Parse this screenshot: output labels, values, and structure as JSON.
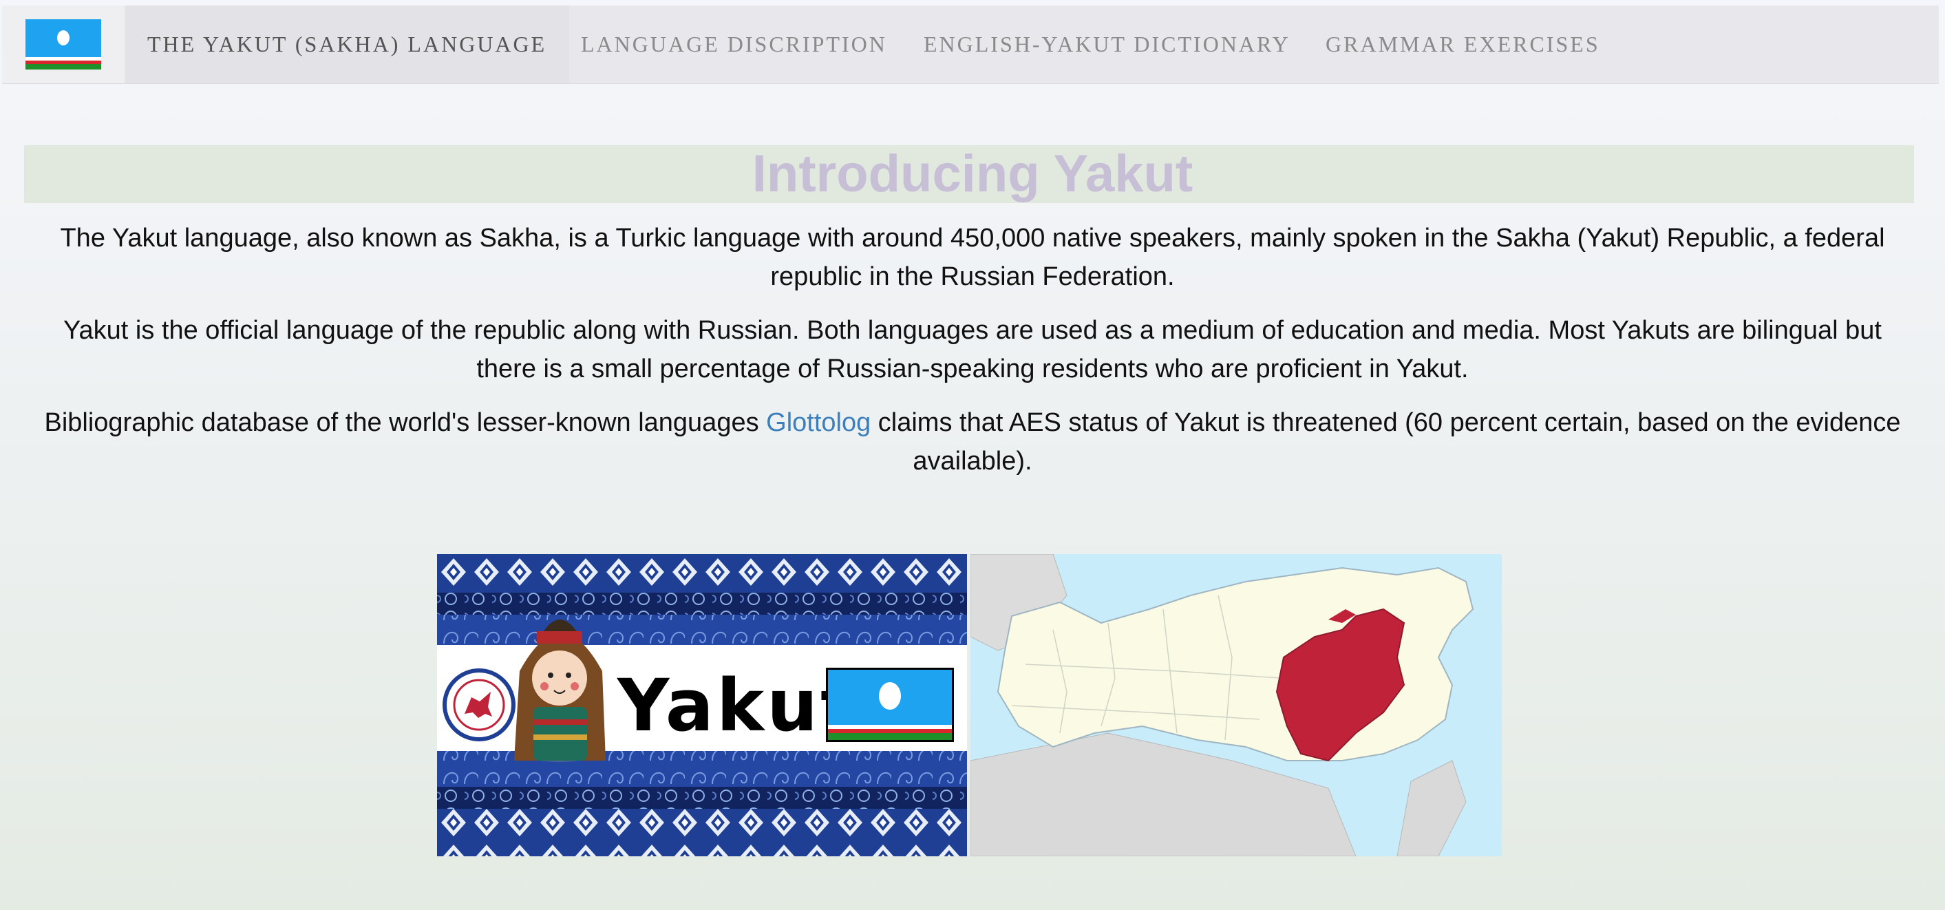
{
  "nav": {
    "brand_icon": "sakha-flag-icon",
    "items": [
      {
        "label": "THE YAKUT (SAKHA) LANGUAGE"
      },
      {
        "label": "LANGUAGE DISCRIPTION"
      },
      {
        "label": "ENGLISH-YAKUT DICTIONARY"
      },
      {
        "label": "GRAMMAR EXERCISES"
      }
    ]
  },
  "main": {
    "title": "Introducing Yakut",
    "paragraphs": {
      "p1": "The Yakut language, also known as Sakha, is a Turkic language with around 450,000 native speakers, mainly spoken in the Sakha (Yakut) Republic, a federal republic in the Russian Federation.",
      "p2": "Yakut is the official language of the republic along with Russian. Both languages are used as a medium of education and media. Most Yakuts are bilingual but there is a small percentage of Russian-speaking residents who are proficient in Yakut.",
      "p3_before": "Bibliographic database of the world's lesser-known languages ",
      "p3_link": "Glottolog",
      "p3_after": " claims that AES status of Yakut is threatened (60 percent certain, based on the evidence available)."
    },
    "banner": {
      "word": "Yakut"
    }
  },
  "colors": {
    "flag_blue": "#1ea3f0",
    "flag_white": "#ffffff",
    "flag_red": "#d9262c",
    "flag_green": "#1f8f2a",
    "title": "#c6bfd6",
    "link": "#3b7fbf",
    "region_red": "#c0223a"
  }
}
